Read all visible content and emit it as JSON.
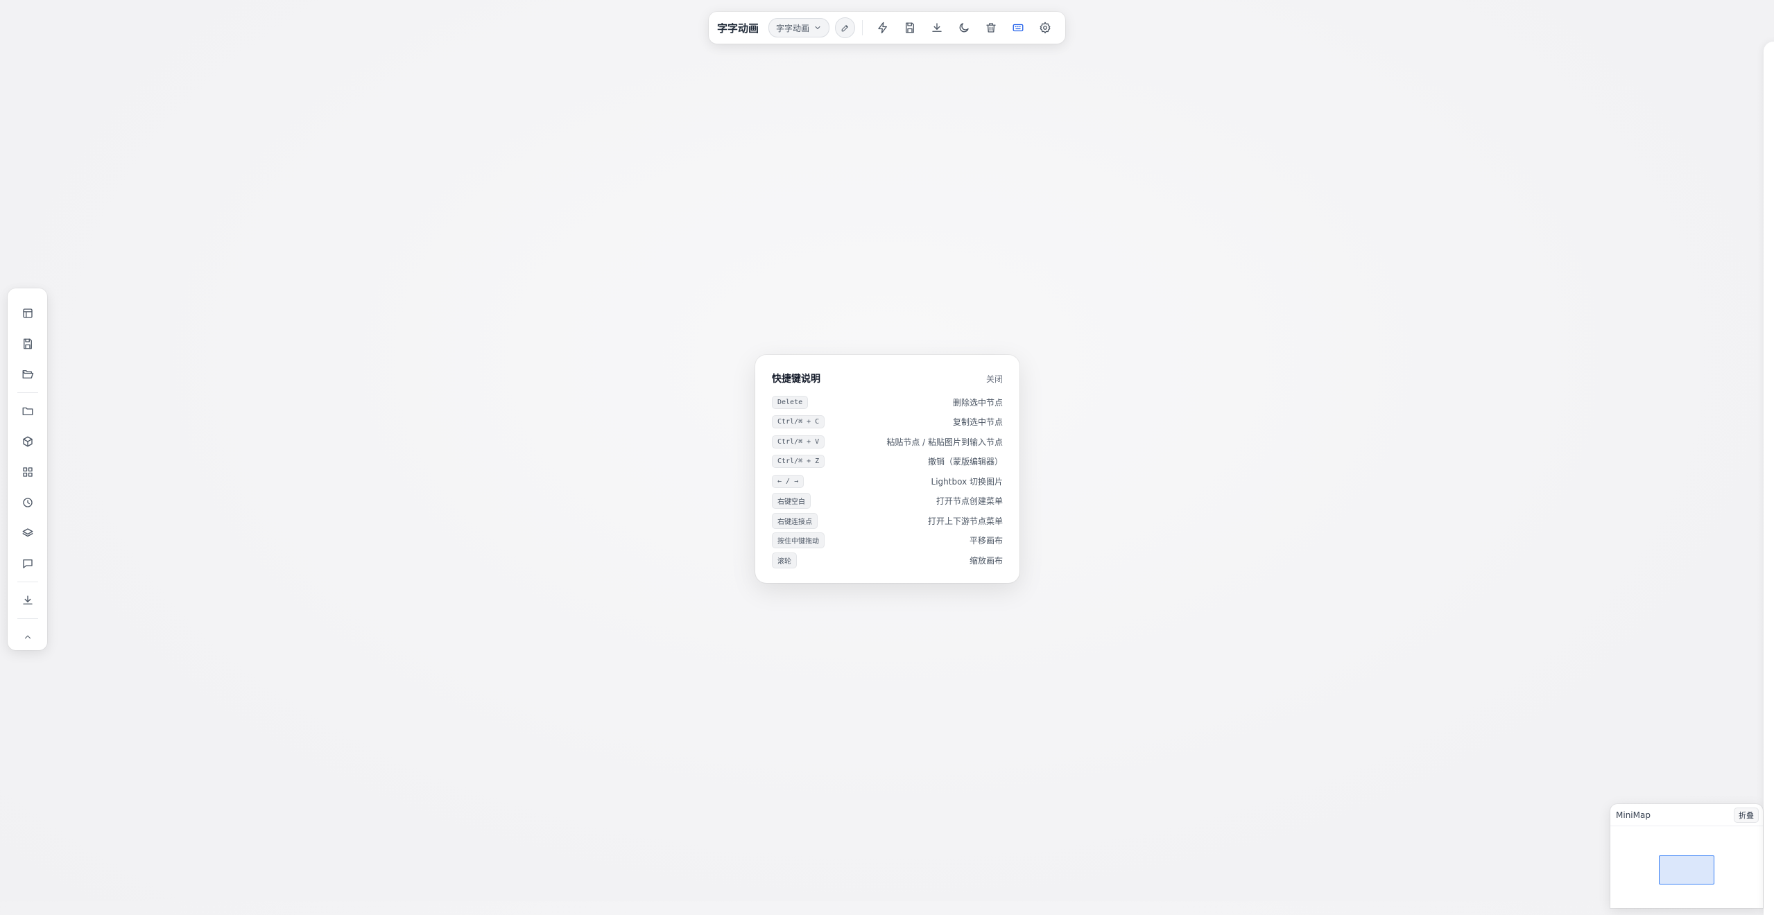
{
  "toolbar": {
    "title": "字字动画",
    "project_select": "字字动画",
    "icons": [
      "chevron-down-icon",
      "pencil-icon",
      "lightning-icon",
      "save-icon",
      "download-icon",
      "moon-icon",
      "trash-icon",
      "keyboard-icon",
      "gear-icon"
    ],
    "active_color": "#2563eb"
  },
  "sidebar": {
    "icons": [
      "layout-icon",
      "save-icon",
      "folder-open-icon",
      "folder-icon",
      "cube-icon",
      "grid-icon",
      "clock-icon",
      "layers-icon",
      "comment-icon",
      "download-icon",
      "chevron-up-icon"
    ]
  },
  "shortcuts": {
    "title": "快捷键说明",
    "close_label": "关闭",
    "rows": [
      {
        "key": "Delete",
        "desc": "删除选中节点"
      },
      {
        "key": "Ctrl/⌘ + C",
        "desc": "复制选中节点"
      },
      {
        "key": "Ctrl/⌘ + V",
        "desc": "粘贴节点 / 粘贴图片到输入节点"
      },
      {
        "key": "Ctrl/⌘ + Z",
        "desc": "撤销（蒙版编辑器）"
      },
      {
        "key": "← / →",
        "desc": "Lightbox 切换图片"
      },
      {
        "key": "右键空白",
        "desc": "打开节点创建菜单"
      },
      {
        "key": "右键连接点",
        "desc": "打开上下游节点菜单"
      },
      {
        "key": "按住中键拖动",
        "desc": "平移画布"
      },
      {
        "key": "滚轮",
        "desc": "缩放画布"
      }
    ]
  },
  "minimap": {
    "title": "MiniMap",
    "collapse_label": "折叠",
    "viewport_color": "#3b82f6"
  }
}
